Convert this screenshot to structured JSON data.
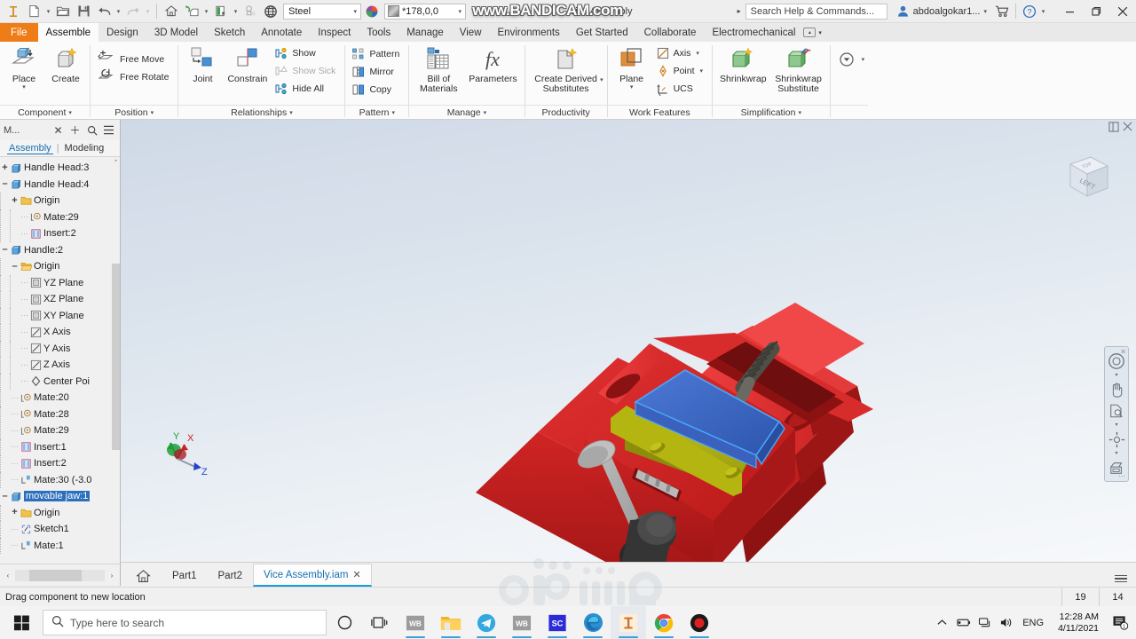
{
  "titlebar": {
    "app_icon": "inventor-icon",
    "quick_access": [
      {
        "name": "new-file",
        "icon": "new-document-icon",
        "caret": true
      },
      {
        "name": "open-file",
        "icon": "open-folder-icon",
        "caret": false
      },
      {
        "name": "save-file",
        "icon": "save-disk-icon",
        "caret": false
      },
      {
        "name": "undo",
        "icon": "undo-arrow-icon",
        "caret": true
      },
      {
        "name": "redo",
        "icon": "redo-arrow-icon",
        "caret": true
      },
      {
        "name": "home-view",
        "icon": "home-icon",
        "caret": false
      },
      {
        "name": "appearance-override",
        "icon": "appearance-icon",
        "caret": true
      },
      {
        "name": "material-override",
        "icon": "material-icon",
        "caret": true
      },
      {
        "name": "clear-overrides",
        "icon": "clear-override-icon",
        "caret": false
      },
      {
        "name": "display-settings",
        "icon": "display-globe-icon",
        "caret": false
      }
    ],
    "material_value": "Steel",
    "appearance_value": "*178,0,0",
    "document_title": "Vice Assembly",
    "help_search_placeholder": "Search Help & Commands...",
    "account_name": "abdoalgokar1...",
    "cart_icon": "shopping-cart-icon",
    "help_icon": "help-circle-icon",
    "minimize": "–",
    "restore": "❐",
    "close": "✕"
  },
  "watermarks": {
    "bandicam": "www.BANDICAM.com",
    "mostaql": "mostaql.com"
  },
  "ribbon_tabs": [
    {
      "label": "File",
      "active": false,
      "file": true
    },
    {
      "label": "Assemble",
      "active": true
    },
    {
      "label": "Design",
      "active": false
    },
    {
      "label": "3D Model",
      "active": false
    },
    {
      "label": "Sketch",
      "active": false
    },
    {
      "label": "Annotate",
      "active": false
    },
    {
      "label": "Inspect",
      "active": false
    },
    {
      "label": "Tools",
      "active": false
    },
    {
      "label": "Manage",
      "active": false
    },
    {
      "label": "View",
      "active": false
    },
    {
      "label": "Environments",
      "active": false
    },
    {
      "label": "Get Started",
      "active": false
    },
    {
      "label": "Collaborate",
      "active": false
    },
    {
      "label": "Electromechanical",
      "active": false
    }
  ],
  "ribbon_panels": {
    "component": {
      "title": "Component",
      "buttons": [
        {
          "label": "Place",
          "icon": "place-component-icon",
          "caret": true
        },
        {
          "label": "Create",
          "icon": "create-component-icon",
          "caret": false
        }
      ]
    },
    "position": {
      "title": "Position",
      "buttons": [
        {
          "label": "Free Move",
          "icon": "free-move-icon"
        },
        {
          "label": "Free Rotate",
          "icon": "free-rotate-icon"
        }
      ]
    },
    "relationships": {
      "title": "Relationships",
      "big_buttons": [
        {
          "label": "Joint",
          "icon": "joint-icon"
        },
        {
          "label": "Constrain",
          "icon": "constrain-icon"
        }
      ],
      "small_buttons": [
        {
          "label": "Show",
          "icon": "show-relationships-icon",
          "disabled": false
        },
        {
          "label": "Show Sick",
          "icon": "show-sick-icon",
          "disabled": true
        },
        {
          "label": "Hide All",
          "icon": "hide-all-icon",
          "disabled": false
        }
      ]
    },
    "pattern": {
      "title": "Pattern",
      "buttons": [
        {
          "label": "Pattern",
          "icon": "pattern-icon"
        },
        {
          "label": "Mirror",
          "icon": "mirror-icon"
        },
        {
          "label": "Copy",
          "icon": "copy-icon"
        }
      ]
    },
    "manage": {
      "title": "Manage",
      "buttons": [
        {
          "label": "Bill of Materials",
          "icon": "bill-of-materials-icon"
        },
        {
          "label": "Parameters",
          "icon": "parameters-fx-icon"
        }
      ]
    },
    "productivity": {
      "title": "Productivity",
      "buttons": [
        {
          "label": "Create Derived Substitutes",
          "icon": "derived-substitute-icon",
          "caret": true
        }
      ]
    },
    "work_features": {
      "title": "Work Features",
      "big_buttons": [
        {
          "label": "Plane",
          "icon": "work-plane-icon",
          "caret": true
        }
      ],
      "small_buttons": [
        {
          "label": "Axis",
          "icon": "work-axis-icon",
          "caret": true
        },
        {
          "label": "Point",
          "icon": "work-point-icon",
          "caret": true
        },
        {
          "label": "UCS",
          "icon": "ucs-icon",
          "caret": false
        }
      ]
    },
    "simplification": {
      "title": "Simplification",
      "buttons": [
        {
          "label": "Shrinkwrap",
          "icon": "shrinkwrap-icon"
        },
        {
          "label": "Shrinkwrap Substitute",
          "icon": "shrinkwrap-substitute-icon"
        }
      ]
    },
    "convert": {
      "title": "",
      "buttons": [
        {
          "label": "",
          "icon": "convert-dropdown-icon",
          "caret": true
        }
      ]
    }
  },
  "browser": {
    "header_title": "M...",
    "header_icons": [
      "close-icon",
      "add-icon",
      "search-icon",
      "menu-icon"
    ],
    "tabs": [
      {
        "label": "Assembly",
        "selected": true
      },
      {
        "label": "Modeling",
        "selected": false
      }
    ],
    "tree": [
      {
        "label": "Handle Head:3",
        "depth": 0,
        "expander": "+",
        "icon": "part-icon"
      },
      {
        "label": "Handle Head:4",
        "depth": 0,
        "expander": "–",
        "icon": "part-icon"
      },
      {
        "label": "Origin",
        "depth": 1,
        "expander": "+",
        "icon": "folder-icon"
      },
      {
        "label": "Mate:29",
        "depth": 2,
        "expander": "",
        "icon": "mate-constraint-icon"
      },
      {
        "label": "Insert:2",
        "depth": 2,
        "expander": "",
        "icon": "insert-constraint-icon"
      },
      {
        "label": "Handle:2",
        "depth": 0,
        "expander": "–",
        "icon": "part-icon"
      },
      {
        "label": "Origin",
        "depth": 1,
        "expander": "–",
        "icon": "folder-open-icon"
      },
      {
        "label": "YZ Plane",
        "depth": 2,
        "expander": "",
        "icon": "plane-icon"
      },
      {
        "label": "XZ Plane",
        "depth": 2,
        "expander": "",
        "icon": "plane-icon"
      },
      {
        "label": "XY Plane",
        "depth": 2,
        "expander": "",
        "icon": "plane-icon"
      },
      {
        "label": "X Axis",
        "depth": 2,
        "expander": "",
        "icon": "axis-icon"
      },
      {
        "label": "Y Axis",
        "depth": 2,
        "expander": "",
        "icon": "axis-icon"
      },
      {
        "label": "Z Axis",
        "depth": 2,
        "expander": "",
        "icon": "axis-icon"
      },
      {
        "label": "Center Poi",
        "depth": 2,
        "expander": "",
        "icon": "center-point-icon"
      },
      {
        "label": "Mate:20",
        "depth": 1,
        "expander": "",
        "icon": "mate-constraint-icon"
      },
      {
        "label": "Mate:28",
        "depth": 1,
        "expander": "",
        "icon": "mate-constraint-icon"
      },
      {
        "label": "Mate:29",
        "depth": 1,
        "expander": "",
        "icon": "mate-constraint-icon"
      },
      {
        "label": "Insert:1",
        "depth": 1,
        "expander": "",
        "icon": "insert-constraint-icon"
      },
      {
        "label": "Insert:2",
        "depth": 1,
        "expander": "",
        "icon": "insert-constraint-icon"
      },
      {
        "label": "Mate:30 (-3.0",
        "depth": 1,
        "expander": "",
        "icon": "flush-constraint-icon"
      },
      {
        "label": "movable jaw:1",
        "depth": 0,
        "expander": "–",
        "icon": "part-icon",
        "selected": true
      },
      {
        "label": "Origin",
        "depth": 1,
        "expander": "+",
        "icon": "folder-icon"
      },
      {
        "label": "Sketch1",
        "depth": 1,
        "expander": "",
        "icon": "sketch-icon"
      },
      {
        "label": "Mate:1",
        "depth": 1,
        "expander": "",
        "icon": "flush-constraint-icon"
      }
    ]
  },
  "viewport": {
    "viewcube_face": "LEFT",
    "viewcube_top": "TOP",
    "axis_labels": {
      "x": "X",
      "y": "Y",
      "z": "Z"
    },
    "axis_colors": {
      "x": "#cc2222",
      "y": "#1f9d3a",
      "z": "#2244cc"
    },
    "model": {
      "name": "vice-assembly",
      "body_color": "#cc1e1e",
      "jaw_top_color": "#3a67c4",
      "jaw_face_color": "#b5b512",
      "screw_color": "#6d6d63",
      "handle_color": "#9b9b9b",
      "knob_color": "#3c3c3c"
    },
    "nav_tools": [
      {
        "name": "steering-wheel-icon",
        "caret": true
      },
      {
        "name": "pan-hand-icon",
        "caret": false
      },
      {
        "name": "zoom-icon",
        "caret": true
      },
      {
        "name": "orbit-icon",
        "caret": true
      },
      {
        "name": "look-at-icon",
        "caret": false
      }
    ],
    "top_right_icons": [
      "window-split-icon",
      "close-icon"
    ]
  },
  "document_tabs": {
    "home_icon": "home-icon",
    "tabs": [
      {
        "label": "Part1",
        "active": false,
        "closable": false
      },
      {
        "label": "Part2",
        "active": false,
        "closable": false
      },
      {
        "label": "Vice Assembly.iam",
        "active": true,
        "closable": true
      }
    ],
    "menu_icon": "hamburger-menu-icon"
  },
  "statusbar": {
    "message": "Drag component to new location",
    "cells": [
      "19",
      "14"
    ]
  },
  "taskbar": {
    "start_icon": "windows-start-icon",
    "search_placeholder": "Type here to search",
    "search_icon": "search-icon",
    "buttons": [
      {
        "name": "cortana-circle-icon",
        "label": ""
      },
      {
        "name": "task-view-icon",
        "label": ""
      },
      {
        "name": "wb-app-icon",
        "label": "WB",
        "running": true
      },
      {
        "name": "file-explorer-icon",
        "label": "",
        "running": true
      },
      {
        "name": "telegram-icon",
        "label": "",
        "running": true
      },
      {
        "name": "wb-app2-icon",
        "label": "WB",
        "running": true
      },
      {
        "name": "sc-app-icon",
        "label": "SC",
        "running": true
      },
      {
        "name": "microsoft-edge-icon",
        "label": "",
        "running": true
      },
      {
        "name": "autodesk-inventor-icon",
        "label": "",
        "running": true,
        "active": true
      },
      {
        "name": "google-chrome-icon",
        "label": "",
        "running": true
      },
      {
        "name": "bandicam-icon",
        "label": "",
        "running": true
      }
    ],
    "tray": {
      "chevron": "show-hidden-icons-icon",
      "icons": [
        "battery-icon",
        "network-icon",
        "volume-icon"
      ],
      "language": "ENG",
      "time": "12:28 AM",
      "date": "4/11/2021",
      "notification_icon": "action-center-icon",
      "notification_count": "1"
    }
  }
}
